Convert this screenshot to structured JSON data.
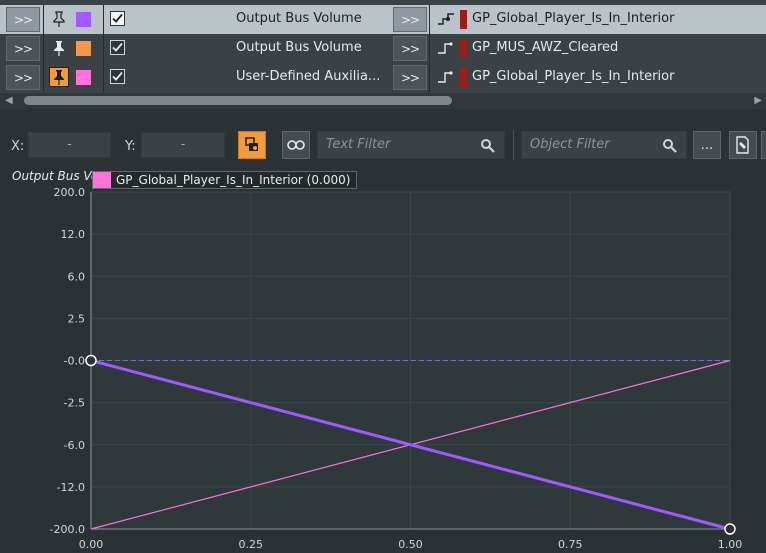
{
  "rows": [
    {
      "arrow": ">>",
      "swatch_color": "#a259ff",
      "property": "Output Bus Volume",
      "arrow2": ">>",
      "state": "GP_Global_Player_Is_In_Interior",
      "selected": true
    },
    {
      "arrow": ">>",
      "swatch_color": "#f5964b",
      "property": "Output Bus Volume",
      "arrow2": ">>",
      "state": "GP_MUS_AWZ_Cleared",
      "selected": false
    },
    {
      "arrow": ">>",
      "swatch_color": "#ff72d9",
      "property": "User-Defined Auxilia...",
      "arrow2": ">>",
      "state": "GP_Global_Player_Is_In_Interior",
      "selected": false
    }
  ],
  "toolbar": {
    "x_label": "X:",
    "x_value": "-",
    "y_label": "Y:",
    "y_value": "-",
    "text_filter_placeholder": "Text Filter",
    "object_filter_placeholder": "Object Filter",
    "more_label": "..."
  },
  "chart_data": {
    "type": "line",
    "ylabel": "Output Bus Vo",
    "y_tick_labels": [
      "200.0",
      "12.0",
      "6.0",
      "2.5",
      "-0.0",
      "-2.5",
      "-6.0",
      "-12.0",
      "-200.0"
    ],
    "x_tick_labels": [
      "0.00",
      "0.25",
      "0.50",
      "0.75",
      "1.00"
    ],
    "xlim": [
      0,
      1
    ],
    "legend": {
      "label": "GP_Global_Player_Is_In_Interior (0.000)",
      "color": "#ff72d9",
      "placement": "top-left"
    },
    "series": [
      {
        "color": "#a259ff",
        "x": [
          0,
          1
        ],
        "y_tick_index": [
          4,
          8
        ]
      },
      {
        "color": "#ff72d9",
        "x": [
          0,
          1
        ],
        "y_tick_index": [
          8,
          4
        ]
      },
      {
        "color": "#6b72c9",
        "dashed": true,
        "x": [
          0,
          1
        ],
        "y_tick_index": [
          4,
          4
        ]
      }
    ]
  }
}
